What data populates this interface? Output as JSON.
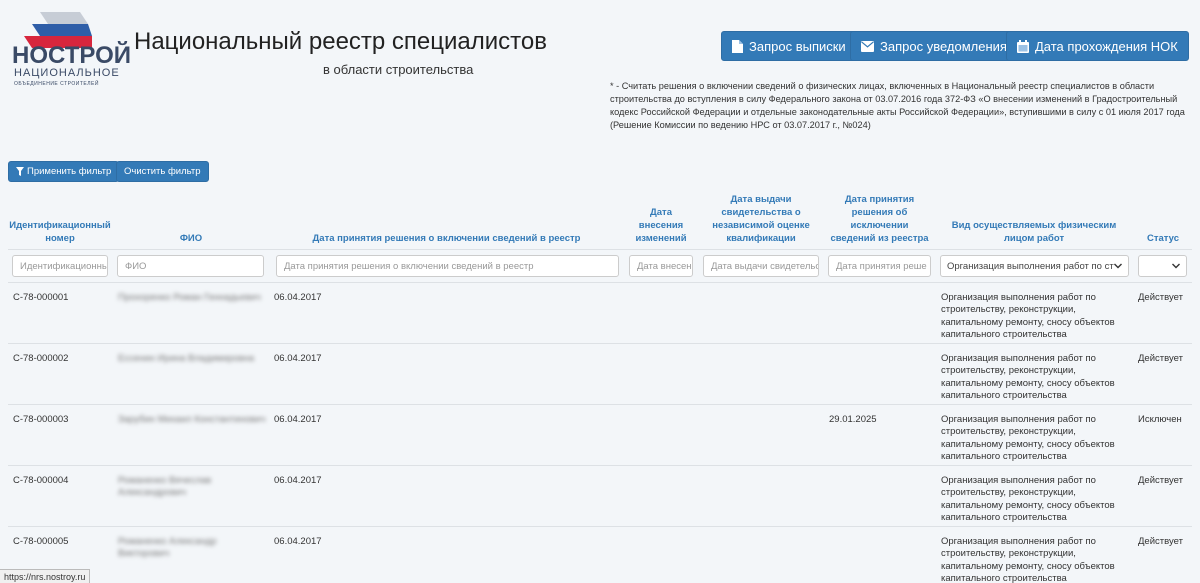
{
  "logo": {
    "main": "НОСТРОЙ",
    "sub": "НАЦИОНАЛЬНОЕ",
    "sub2": "ОБЪЕДИНЕНИЕ СТРОИТЕЛЕЙ",
    "colors": [
      "#c7cdd6",
      "#2f5ea8",
      "#d7263d"
    ]
  },
  "header": {
    "title": "Национальный реестр специалистов",
    "subtitle": "в области строительства"
  },
  "buttons": {
    "extract": "Запрос выписки",
    "notify": "Запрос уведомления",
    "nok": "Дата прохождения НОК"
  },
  "note": "* - Считать решения о включении сведений о физических лицах, включенных в Национальный реестр специалистов в области строительства до вступления в силу Федерального закона от 03.07.2016 года 372-ФЗ «О внесении изменений в Градостроительный кодекс Российской Федерации и отдельные законодательные акты Российской Федерации», вступившими в силу с 01 июля 2017 года (Решение Комиссии по ведению НРС от 03.07.2017 г., №024)",
  "filter": {
    "apply": "Применить фильтр",
    "clear": "Очистить фильтр"
  },
  "table": {
    "headers": {
      "id": "Идентификационный номер",
      "fio": "ФИО",
      "include_date": "Дата принятия решения о включении сведений в реестр",
      "change_date": "Дата внесения изменений",
      "cert_date": "Дата выдачи свидетельства о независимой оценке квалификации",
      "exclude_date": "Дата принятия решения об исключении сведений из реестра",
      "activity": "Вид осуществляемых физическим лицом работ",
      "status": "Статус"
    },
    "filters": {
      "id": "Идентификационный",
      "fio": "ФИО",
      "include_date": "Дата принятия решения о включении сведений в реестр",
      "change_date": "Дата внесен",
      "cert_date": "Дата выдачи свидетельс",
      "exclude_date": "Дата принятия реше",
      "activity": "Организация выполнения работ по стр",
      "status": ""
    },
    "rows": [
      {
        "id": "С-78-000001",
        "fio": "Прохоренко Роман Геннадьевич",
        "include_date": "06.04.2017",
        "change_date": "",
        "cert_date": "",
        "exclude_date": "",
        "activity": "Организация выполнения работ по строительству, реконструкции, капитальному ремонту, сносу объектов капитального строительства",
        "status": "Действует"
      },
      {
        "id": "С-78-000002",
        "fio": "Ессенин Ирина Владимировна",
        "include_date": "06.04.2017",
        "change_date": "",
        "cert_date": "",
        "exclude_date": "",
        "activity": "Организация выполнения работ по строительству, реконструкции, капитальному ремонту, сносу объектов капитального строительства",
        "status": "Действует"
      },
      {
        "id": "С-78-000003",
        "fio": "Зарубин Михаил Константинович",
        "include_date": "06.04.2017",
        "change_date": "",
        "cert_date": "",
        "exclude_date": "29.01.2025",
        "activity": "Организация выполнения работ по строительству, реконструкции, капитальному ремонту, сносу объектов капитального строительства",
        "status": "Исключен"
      },
      {
        "id": "С-78-000004",
        "fio": "Романенко Вячеслав Александрович",
        "include_date": "06.04.2017",
        "change_date": "",
        "cert_date": "",
        "exclude_date": "",
        "activity": "Организация выполнения работ по строительству, реконструкции, капитальному ремонту, сносу объектов капитального строительства",
        "status": "Действует"
      },
      {
        "id": "С-78-000005",
        "fio": "Романенко Александр Викторович",
        "include_date": "06.04.2017",
        "change_date": "",
        "cert_date": "",
        "exclude_date": "",
        "activity": "Организация выполнения работ по строительству, реконструкции, капитальному ремонту, сносу объектов капитального строительства",
        "status": "Действует"
      }
    ]
  },
  "statusbar": "https://nrs.nostroy.ru",
  "colors": {
    "accent": "#337ab7",
    "background": "#f3f6f9"
  }
}
